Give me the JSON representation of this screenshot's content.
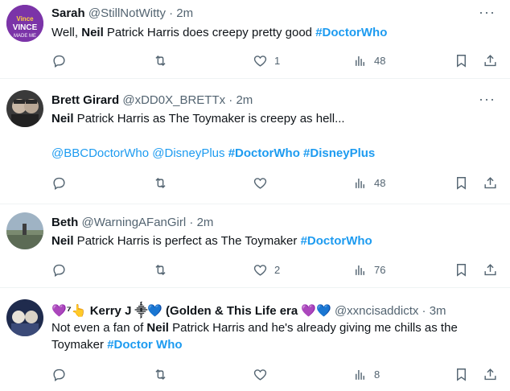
{
  "tweets": [
    {
      "name": "Sarah",
      "handle": "@StillNotWitty",
      "time": "2m",
      "text": [
        {
          "t": "Well, "
        },
        {
          "b": "Neil"
        },
        {
          "t": " Patrick Harris does creepy pretty good "
        },
        {
          "tag": "#DoctorWho"
        }
      ],
      "text2": null,
      "reply": "",
      "retweet": "",
      "like": "1",
      "views": "48"
    },
    {
      "name": "Brett Girard",
      "handle": "@xDD0X_BRETTx",
      "time": "2m",
      "text": [
        {
          "b": "Neil"
        },
        {
          "t": " Patrick Harris as The Toymaker is creepy as hell..."
        }
      ],
      "text2": [
        {
          "m": "@BBCDoctorWho"
        },
        {
          "t": " "
        },
        {
          "m": "@DisneyPlus"
        },
        {
          "t": " "
        },
        {
          "tag": "#DoctorWho"
        },
        {
          "t": " "
        },
        {
          "tag": "#DisneyPlus"
        }
      ],
      "reply": "",
      "retweet": "",
      "like": "",
      "views": "48"
    },
    {
      "name": "Beth",
      "handle": "@WarningAFanGirl",
      "time": "2m",
      "text": [
        {
          "b": "Neil"
        },
        {
          "t": " Patrick Harris is perfect as The Toymaker "
        },
        {
          "tag": "#DoctorWho"
        }
      ],
      "text2": null,
      "reply": "",
      "retweet": "",
      "like": "2",
      "views": "76"
    },
    {
      "name": "💜⁷👆 Kerry J ⸎💙 (Golden & This Life era 💜💙",
      "handle": "@xxncisaddictx",
      "time": "3m",
      "text": [
        {
          "t": "Not even a fan of "
        },
        {
          "b": "Neil"
        },
        {
          "t": " Patrick Harris and he's already giving me chills as the"
        }
      ],
      "text2": [
        {
          "t": "Toymaker "
        },
        {
          "tag": "#Doctor Who"
        }
      ],
      "reply": "",
      "retweet": "",
      "like": "",
      "views": "8"
    }
  ],
  "dot": "·",
  "more_glyph": "···",
  "colors": {
    "link": "#1d9bf0",
    "muted": "#536471",
    "divider": "#eff3f4"
  }
}
